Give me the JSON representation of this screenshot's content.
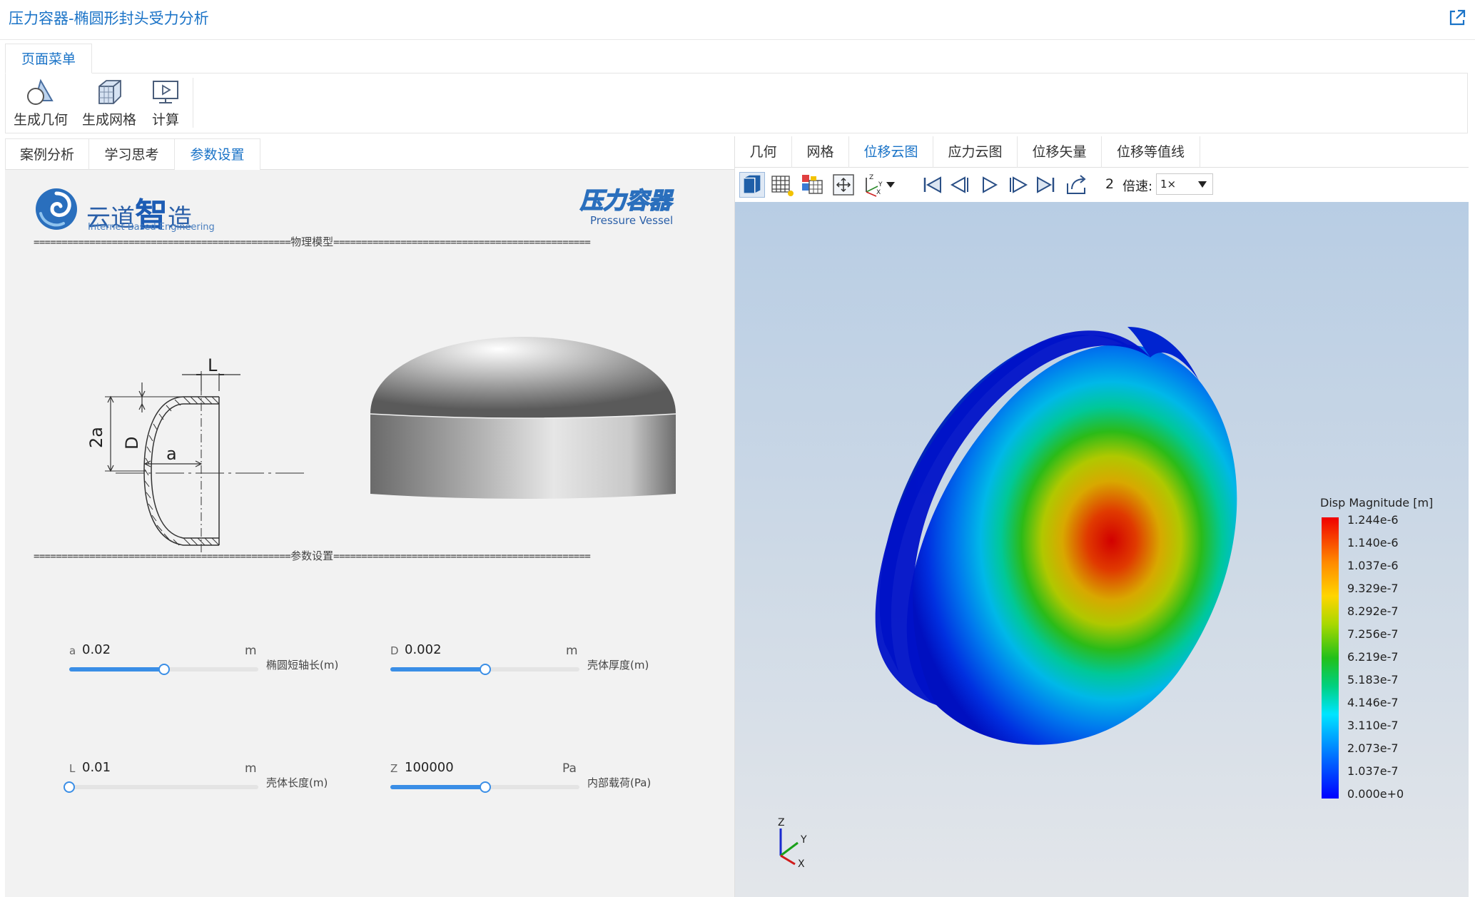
{
  "window": {
    "title": "压力容器-椭圆形封头受力分析",
    "external_icon": "external-link-icon"
  },
  "menu": {
    "tab_label": "页面菜单",
    "buttons": [
      {
        "label": "生成几何",
        "icon": "geometry-icon"
      },
      {
        "label": "生成网格",
        "icon": "mesh-cube-icon"
      },
      {
        "label": "计算",
        "icon": "compute-monitor-icon"
      }
    ]
  },
  "left": {
    "tabs": [
      {
        "label": "案例分析"
      },
      {
        "label": "学习思考"
      },
      {
        "label": "参数设置",
        "active": true
      }
    ],
    "logo_yd": {
      "name": "云道",
      "name2": "智",
      "name3": "造",
      "sub": "Internet Based Engineering"
    },
    "logo_pv": {
      "name": "压力容器",
      "sub": "Pressure Vessel"
    },
    "sections": {
      "model": "物理模型",
      "params": "参数设置",
      "rule": "=============================================="
    },
    "drawing_labels": {
      "L": "L",
      "D": "D",
      "a2": "2a",
      "a": "a"
    },
    "params": [
      {
        "sym": "a",
        "value": "0.02",
        "unit": "m",
        "desc": "椭圆短轴长(m)",
        "fraction": 0.5
      },
      {
        "sym": "D",
        "value": "0.002",
        "unit": "m",
        "desc": "壳体厚度(m)",
        "fraction": 0.5
      },
      {
        "sym": "L",
        "value": "0.01",
        "unit": "m",
        "desc": "壳体长度(m)",
        "fraction": 0.0
      },
      {
        "sym": "Z",
        "value": "100000",
        "unit": "Pa",
        "desc": "内部载荷(Pa)",
        "fraction": 0.5
      }
    ]
  },
  "right": {
    "tabs": [
      {
        "label": "几何"
      },
      {
        "label": "网格"
      },
      {
        "label": "位移云图",
        "active": true
      },
      {
        "label": "应力云图"
      },
      {
        "label": "位移矢量"
      },
      {
        "label": "位移等值线"
      }
    ],
    "toolbar": {
      "icons": [
        "surface-view-icon",
        "wireframe-icon",
        "colormap-settings-icon",
        "fit-view-icon",
        "axes-orientation-icon",
        "first-frame-icon",
        "previous-frame-icon",
        "play-icon",
        "next-frame-icon",
        "last-frame-icon",
        "export-icon"
      ],
      "frame": "2",
      "speed_label": "倍速:",
      "speed_value": "1×"
    },
    "legend": {
      "title": "Disp Magnitude [m]",
      "values": [
        "1.244e-6",
        "1.140e-6",
        "1.037e-6",
        "9.329e-7",
        "8.292e-7",
        "7.256e-7",
        "6.219e-7",
        "5.183e-7",
        "4.146e-7",
        "3.110e-7",
        "2.073e-7",
        "1.037e-7",
        "0.000e+0"
      ]
    },
    "axes": {
      "z": "Z",
      "y": "Y",
      "x": "X"
    }
  }
}
